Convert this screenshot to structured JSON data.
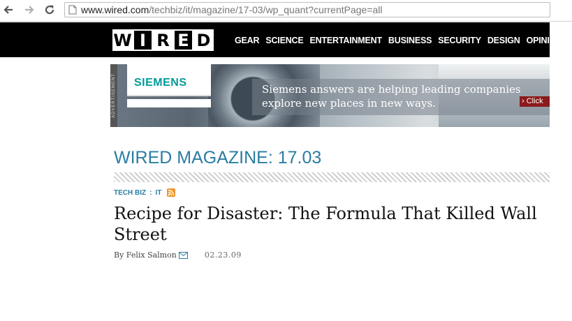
{
  "browser": {
    "url_host": "www.wired.com",
    "url_path": "/techbiz/it/magazine/17-03/wp_quant?currentPage=all"
  },
  "header": {
    "logo_letters": [
      "W",
      "I",
      "R",
      "E",
      "D"
    ],
    "nav": [
      "GEAR",
      "SCIENCE",
      "ENTERTAINMENT",
      "BUSINESS",
      "SECURITY",
      "DESIGN",
      "OPINIO"
    ]
  },
  "ad": {
    "label": "ADVERTISEMENT",
    "brand": "SIEMENS",
    "copy_line1": "Siemens answers are helping leading companies",
    "copy_line2": "explore new places in new ways.",
    "cta": "Click"
  },
  "article": {
    "magazine_label": "WIRED MAGAZINE: 17.03",
    "crumbs": [
      "TECH BIZ",
      ":",
      "IT"
    ],
    "title": "Recipe for Disaster: The Formula That Killed Wall Street",
    "byline": "By Felix Salmon",
    "date": "02.23.09"
  },
  "colors": {
    "accent": "#2a7da2",
    "siemens": "#009999",
    "rss": "#f0952c",
    "cta_bg": "#8b1a1a"
  }
}
